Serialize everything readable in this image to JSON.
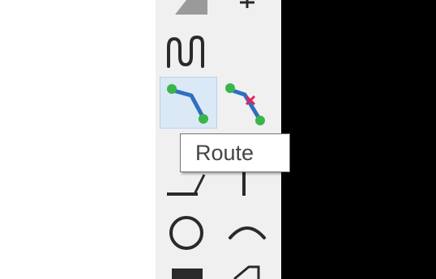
{
  "colors": {
    "toolbar_bg": "#f0f0f0",
    "active_bg": "#dbe8f5",
    "icon_line": "#2a2a2a",
    "route_blue": "#2f6fc0",
    "route_green": "#39b54a",
    "route_red_x": "#e0245e"
  },
  "tools": [
    {
      "name": "shape-tool-partial",
      "icon": "gray-shape-icon"
    },
    {
      "name": "plus-tool-partial",
      "icon": "plus-icon"
    },
    {
      "name": "meander-tool",
      "icon": "meander-icon"
    },
    {
      "name": "route-tool",
      "icon": "route-icon",
      "active": true
    },
    {
      "name": "unroute-tool",
      "icon": "route-remove-icon"
    },
    {
      "name": "line-tool",
      "icon": "line-icon"
    },
    {
      "name": "vertical-line-tool",
      "icon": "vertical-line-icon"
    },
    {
      "name": "circle-tool",
      "icon": "circle-icon"
    },
    {
      "name": "arc-tool",
      "icon": "arc-icon"
    },
    {
      "name": "rectangle-tool",
      "icon": "filled-rect-icon"
    },
    {
      "name": "polygon-tool",
      "icon": "polygon-icon"
    }
  ],
  "tooltip": {
    "text": "Route"
  }
}
